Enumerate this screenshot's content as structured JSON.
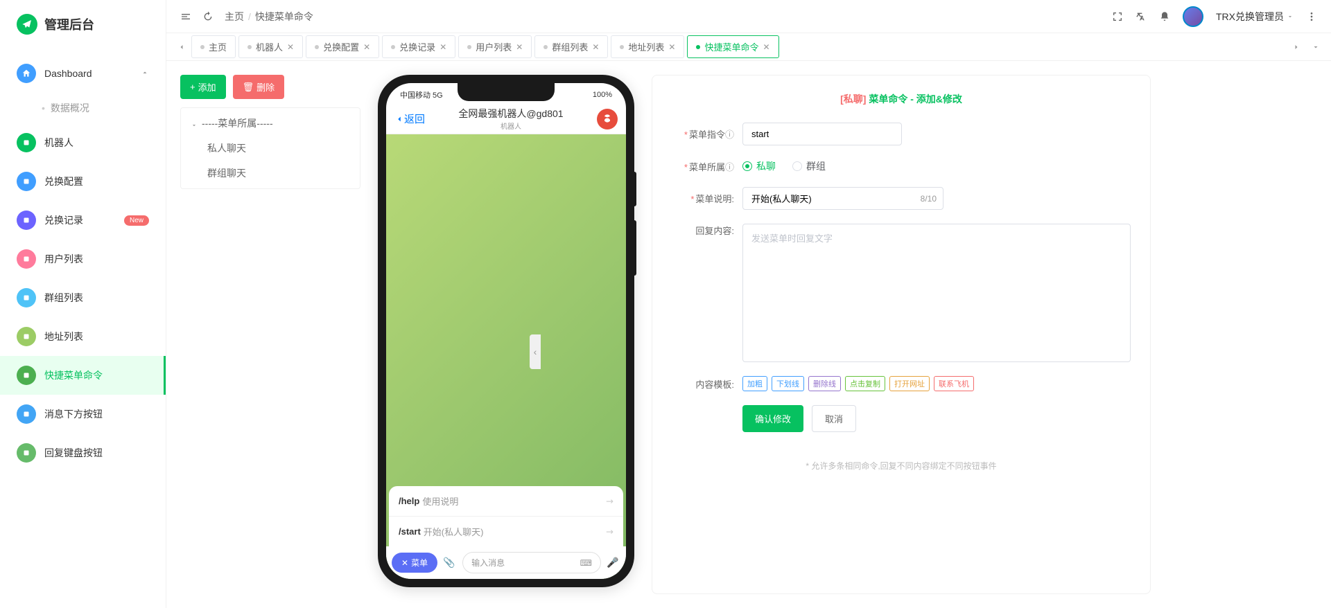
{
  "logo": {
    "text": "管理后台"
  },
  "sidebar": {
    "dashboard": "Dashboard",
    "dashboard_sub": "数据概况",
    "items": [
      {
        "label": "机器人",
        "color": "#07c160"
      },
      {
        "label": "兑换配置",
        "color": "#409eff"
      },
      {
        "label": "兑换记录",
        "color": "#6c63ff",
        "badge": "New"
      },
      {
        "label": "用户列表",
        "color": "#ff7b9c"
      },
      {
        "label": "群组列表",
        "color": "#4fc3f7"
      },
      {
        "label": "地址列表",
        "color": "#9ccc65"
      },
      {
        "label": "快捷菜单命令",
        "color": "#4caf50",
        "active": true
      },
      {
        "label": "消息下方按钮",
        "color": "#42a5f5"
      },
      {
        "label": "回复键盘按钮",
        "color": "#66bb6a"
      }
    ]
  },
  "header": {
    "breadcrumb_home": "主页",
    "breadcrumb_current": "快捷菜单命令",
    "user": "TRX兑换管理员"
  },
  "tabs": [
    {
      "label": "主页"
    },
    {
      "label": "机器人",
      "closable": true
    },
    {
      "label": "兑换配置",
      "closable": true
    },
    {
      "label": "兑换记录",
      "closable": true
    },
    {
      "label": "用户列表",
      "closable": true
    },
    {
      "label": "群组列表",
      "closable": true
    },
    {
      "label": "地址列表",
      "closable": true
    },
    {
      "label": "快捷菜单命令",
      "closable": true,
      "active": true
    }
  ],
  "actions": {
    "add": "添加",
    "delete": "删除"
  },
  "tree": {
    "root": "-----菜单所属-----",
    "children": [
      "私人聊天",
      "群组聊天"
    ]
  },
  "phone": {
    "carrier": "中国移动 5G",
    "battery": "100%",
    "back": "返回",
    "title": "全网最强机器人@gd801",
    "subtitle": "机器人",
    "cmds": [
      {
        "cmd": "/help",
        "desc": "使用说明"
      },
      {
        "cmd": "/start",
        "desc": "开始(私人聊天)"
      }
    ],
    "menu_btn": "菜单",
    "input_placeholder": "输入消息"
  },
  "form": {
    "title_prefix": "[私聊]",
    "title_main": "菜单命令 - 添加&修改",
    "label_cmd": "菜单指令",
    "value_cmd": "start",
    "label_owner": "菜单所属",
    "radio_private": "私聊",
    "radio_group": "群组",
    "label_desc": "菜单说明:",
    "value_desc": "开始(私人聊天)",
    "desc_count": "8/10",
    "label_reply": "回复内容:",
    "reply_placeholder": "发送菜单时回复文字",
    "label_tmpl": "内容模板:",
    "templates": [
      {
        "text": "加粗",
        "color": "#409eff"
      },
      {
        "text": "下划线",
        "color": "#409eff"
      },
      {
        "text": "删除线",
        "color": "#9575cd"
      },
      {
        "text": "点击复制",
        "color": "#67c23a"
      },
      {
        "text": "打开网址",
        "color": "#e6a23c"
      },
      {
        "text": "联系飞机",
        "color": "#f56c6c"
      }
    ],
    "submit": "确认修改",
    "cancel": "取消",
    "hint": "* 允许多条相同命令,回复不同内容绑定不同按钮事件"
  }
}
